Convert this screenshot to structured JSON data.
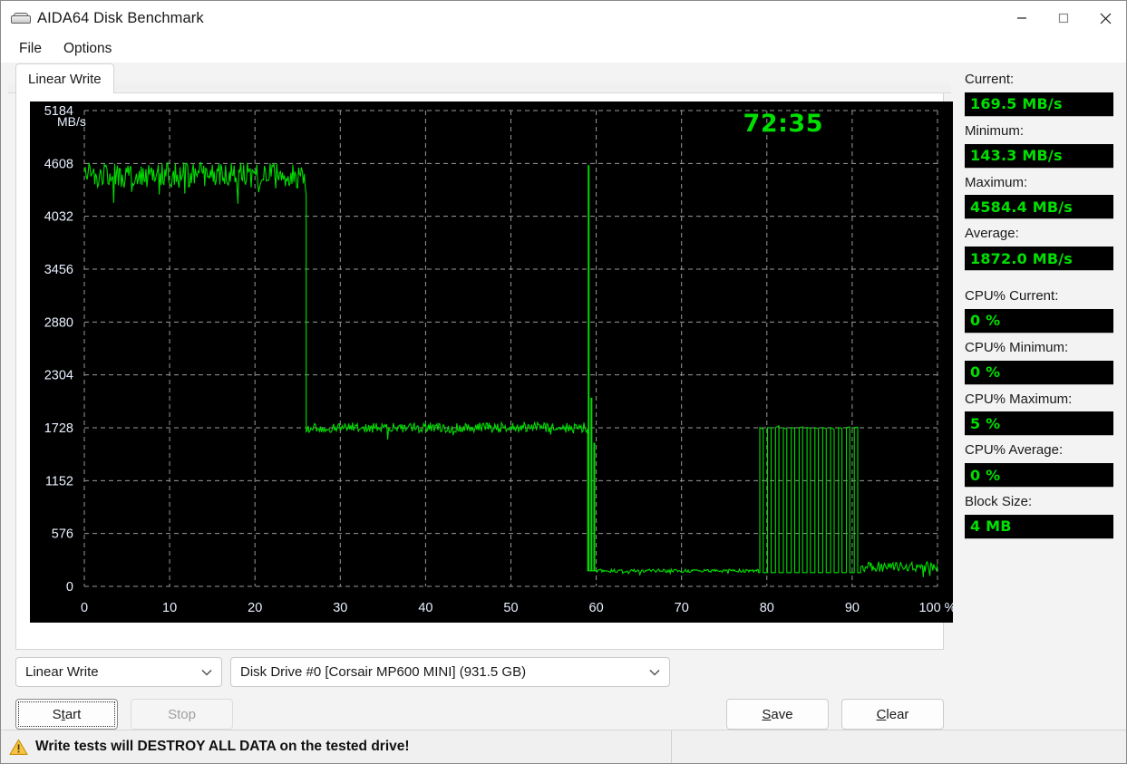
{
  "window": {
    "title": "AIDA64 Disk Benchmark",
    "icon": "disk-icon",
    "minimize_label": "Minimize",
    "maximize_label": "Maximize",
    "close_label": "Close"
  },
  "menu": {
    "items": [
      {
        "label": "File"
      },
      {
        "label": "Options"
      }
    ]
  },
  "tabs": [
    {
      "label": "Linear Write",
      "selected": true
    }
  ],
  "chart_panel": {
    "timer": "72:35"
  },
  "controls": {
    "mode_select": {
      "value": "Linear Write",
      "chevron": "chevron-down-icon"
    },
    "drive_select": {
      "value": "Disk Drive #0  [Corsair MP600 MINI]  (931.5 GB)",
      "chevron": "chevron-down-icon"
    },
    "start_label": "Start",
    "start_accel": "t",
    "stop_label": "Stop",
    "stop_disabled": true,
    "save_label": "Save",
    "save_accel": "S",
    "clear_label": "Clear",
    "clear_accel": "C"
  },
  "stats": [
    {
      "caption": "Current:",
      "value": "169.5 MB/s",
      "gap": false
    },
    {
      "caption": "Minimum:",
      "value": "143.3 MB/s",
      "gap": false
    },
    {
      "caption": "Maximum:",
      "value": "4584.4 MB/s",
      "gap": false
    },
    {
      "caption": "Average:",
      "value": "1872.0 MB/s",
      "gap": false
    },
    {
      "caption": "CPU% Current:",
      "value": "0 %",
      "gap": true
    },
    {
      "caption": "CPU% Minimum:",
      "value": "0 %",
      "gap": false
    },
    {
      "caption": "CPU% Maximum:",
      "value": "5 %",
      "gap": false
    },
    {
      "caption": "CPU% Average:",
      "value": "0 %",
      "gap": false
    },
    {
      "caption": "Block Size:",
      "value": "4 MB",
      "gap": false
    }
  ],
  "statusbar": {
    "warning_icon": "warning-triangle-icon",
    "warning_text": "Write tests will DESTROY ALL DATA on the tested drive!"
  },
  "colors": {
    "trace_green": "#00dd00",
    "value_green": "#00e000",
    "panel_black": "#000000",
    "grid_gray": "#9a9a9a",
    "tick_label": "#e8f0ff",
    "warning_amber": "#f0b323"
  },
  "chart_data": {
    "type": "line",
    "title": "",
    "xlabel": "%",
    "ylabel": "MB/s",
    "xlim": [
      0,
      100
    ],
    "ylim": [
      0,
      5184
    ],
    "grid": true,
    "legend": false,
    "xticks": [
      0,
      10,
      20,
      30,
      40,
      50,
      60,
      70,
      80,
      90,
      100
    ],
    "xtick_labels": [
      "0",
      "10",
      "20",
      "30",
      "40",
      "50",
      "60",
      "70",
      "80",
      "90",
      "100 %"
    ],
    "yticks": [
      0,
      576,
      1152,
      1728,
      2304,
      2880,
      3456,
      4032,
      4608,
      5184
    ],
    "ytick_labels": [
      "0",
      "576",
      "1152",
      "1728",
      "2304",
      "2880",
      "3456",
      "4032",
      "4608",
      "5184"
    ],
    "series": [
      {
        "name": "Linear Write",
        "color": "#00dd00",
        "description": "SLC cache burst ~4500 MB/s to 26%, steady ~1730 MB/s to 59%, spike cluster, folding floor ~170 MB/s to 79%, square-wave burst to 91%, noisy tail ~200 MB/s",
        "segments": [
          {
            "x_start": 0,
            "x_end": 26,
            "level": 4480,
            "noise": 140,
            "kind": "noisy-plateau"
          },
          {
            "x_start": 26,
            "x_end": 59,
            "level": 1730,
            "noise": 55,
            "kind": "noisy-plateau"
          },
          {
            "x_start": 59,
            "x_end": 60,
            "level": 170,
            "noise": 0,
            "kind": "spike-cluster",
            "spikes": [
              4584,
              2050,
              1560
            ]
          },
          {
            "x_start": 60,
            "x_end": 79,
            "level": 170,
            "noise": 18,
            "kind": "low-floor"
          },
          {
            "x_start": 79,
            "x_end": 91,
            "level": 170,
            "noise": 0,
            "kind": "square-wave",
            "high": 1730,
            "low": 150,
            "cycles": 13
          },
          {
            "x_start": 91,
            "x_end": 100,
            "level": 215,
            "noise": 55,
            "kind": "noisy-plateau"
          }
        ]
      }
    ]
  }
}
